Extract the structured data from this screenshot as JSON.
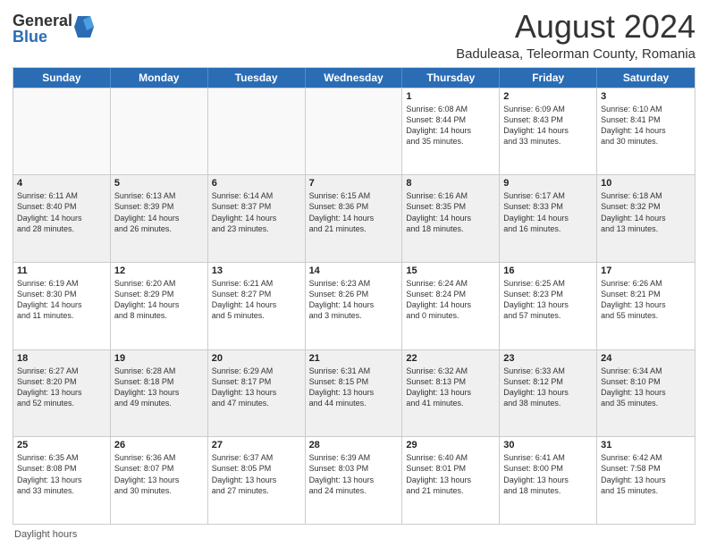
{
  "logo": {
    "general": "General",
    "blue": "Blue"
  },
  "title": "August 2024",
  "subtitle": "Baduleasa, Teleorman County, Romania",
  "header": {
    "days": [
      "Sunday",
      "Monday",
      "Tuesday",
      "Wednesday",
      "Thursday",
      "Friday",
      "Saturday"
    ]
  },
  "footer": {
    "daylight_label": "Daylight hours"
  },
  "weeks": [
    [
      {
        "day": "",
        "content": "",
        "empty": true
      },
      {
        "day": "",
        "content": "",
        "empty": true
      },
      {
        "day": "",
        "content": "",
        "empty": true
      },
      {
        "day": "",
        "content": "",
        "empty": true
      },
      {
        "day": "1",
        "content": "Sunrise: 6:08 AM\nSunset: 8:44 PM\nDaylight: 14 hours\nand 35 minutes.",
        "empty": false
      },
      {
        "day": "2",
        "content": "Sunrise: 6:09 AM\nSunset: 8:43 PM\nDaylight: 14 hours\nand 33 minutes.",
        "empty": false
      },
      {
        "day": "3",
        "content": "Sunrise: 6:10 AM\nSunset: 8:41 PM\nDaylight: 14 hours\nand 30 minutes.",
        "empty": false
      }
    ],
    [
      {
        "day": "4",
        "content": "Sunrise: 6:11 AM\nSunset: 8:40 PM\nDaylight: 14 hours\nand 28 minutes.",
        "empty": false
      },
      {
        "day": "5",
        "content": "Sunrise: 6:13 AM\nSunset: 8:39 PM\nDaylight: 14 hours\nand 26 minutes.",
        "empty": false
      },
      {
        "day": "6",
        "content": "Sunrise: 6:14 AM\nSunset: 8:37 PM\nDaylight: 14 hours\nand 23 minutes.",
        "empty": false
      },
      {
        "day": "7",
        "content": "Sunrise: 6:15 AM\nSunset: 8:36 PM\nDaylight: 14 hours\nand 21 minutes.",
        "empty": false
      },
      {
        "day": "8",
        "content": "Sunrise: 6:16 AM\nSunset: 8:35 PM\nDaylight: 14 hours\nand 18 minutes.",
        "empty": false
      },
      {
        "day": "9",
        "content": "Sunrise: 6:17 AM\nSunset: 8:33 PM\nDaylight: 14 hours\nand 16 minutes.",
        "empty": false
      },
      {
        "day": "10",
        "content": "Sunrise: 6:18 AM\nSunset: 8:32 PM\nDaylight: 14 hours\nand 13 minutes.",
        "empty": false
      }
    ],
    [
      {
        "day": "11",
        "content": "Sunrise: 6:19 AM\nSunset: 8:30 PM\nDaylight: 14 hours\nand 11 minutes.",
        "empty": false
      },
      {
        "day": "12",
        "content": "Sunrise: 6:20 AM\nSunset: 8:29 PM\nDaylight: 14 hours\nand 8 minutes.",
        "empty": false
      },
      {
        "day": "13",
        "content": "Sunrise: 6:21 AM\nSunset: 8:27 PM\nDaylight: 14 hours\nand 5 minutes.",
        "empty": false
      },
      {
        "day": "14",
        "content": "Sunrise: 6:23 AM\nSunset: 8:26 PM\nDaylight: 14 hours\nand 3 minutes.",
        "empty": false
      },
      {
        "day": "15",
        "content": "Sunrise: 6:24 AM\nSunset: 8:24 PM\nDaylight: 14 hours\nand 0 minutes.",
        "empty": false
      },
      {
        "day": "16",
        "content": "Sunrise: 6:25 AM\nSunset: 8:23 PM\nDaylight: 13 hours\nand 57 minutes.",
        "empty": false
      },
      {
        "day": "17",
        "content": "Sunrise: 6:26 AM\nSunset: 8:21 PM\nDaylight: 13 hours\nand 55 minutes.",
        "empty": false
      }
    ],
    [
      {
        "day": "18",
        "content": "Sunrise: 6:27 AM\nSunset: 8:20 PM\nDaylight: 13 hours\nand 52 minutes.",
        "empty": false
      },
      {
        "day": "19",
        "content": "Sunrise: 6:28 AM\nSunset: 8:18 PM\nDaylight: 13 hours\nand 49 minutes.",
        "empty": false
      },
      {
        "day": "20",
        "content": "Sunrise: 6:29 AM\nSunset: 8:17 PM\nDaylight: 13 hours\nand 47 minutes.",
        "empty": false
      },
      {
        "day": "21",
        "content": "Sunrise: 6:31 AM\nSunset: 8:15 PM\nDaylight: 13 hours\nand 44 minutes.",
        "empty": false
      },
      {
        "day": "22",
        "content": "Sunrise: 6:32 AM\nSunset: 8:13 PM\nDaylight: 13 hours\nand 41 minutes.",
        "empty": false
      },
      {
        "day": "23",
        "content": "Sunrise: 6:33 AM\nSunset: 8:12 PM\nDaylight: 13 hours\nand 38 minutes.",
        "empty": false
      },
      {
        "day": "24",
        "content": "Sunrise: 6:34 AM\nSunset: 8:10 PM\nDaylight: 13 hours\nand 35 minutes.",
        "empty": false
      }
    ],
    [
      {
        "day": "25",
        "content": "Sunrise: 6:35 AM\nSunset: 8:08 PM\nDaylight: 13 hours\nand 33 minutes.",
        "empty": false
      },
      {
        "day": "26",
        "content": "Sunrise: 6:36 AM\nSunset: 8:07 PM\nDaylight: 13 hours\nand 30 minutes.",
        "empty": false
      },
      {
        "day": "27",
        "content": "Sunrise: 6:37 AM\nSunset: 8:05 PM\nDaylight: 13 hours\nand 27 minutes.",
        "empty": false
      },
      {
        "day": "28",
        "content": "Sunrise: 6:39 AM\nSunset: 8:03 PM\nDaylight: 13 hours\nand 24 minutes.",
        "empty": false
      },
      {
        "day": "29",
        "content": "Sunrise: 6:40 AM\nSunset: 8:01 PM\nDaylight: 13 hours\nand 21 minutes.",
        "empty": false
      },
      {
        "day": "30",
        "content": "Sunrise: 6:41 AM\nSunset: 8:00 PM\nDaylight: 13 hours\nand 18 minutes.",
        "empty": false
      },
      {
        "day": "31",
        "content": "Sunrise: 6:42 AM\nSunset: 7:58 PM\nDaylight: 13 hours\nand 15 minutes.",
        "empty": false
      }
    ]
  ]
}
